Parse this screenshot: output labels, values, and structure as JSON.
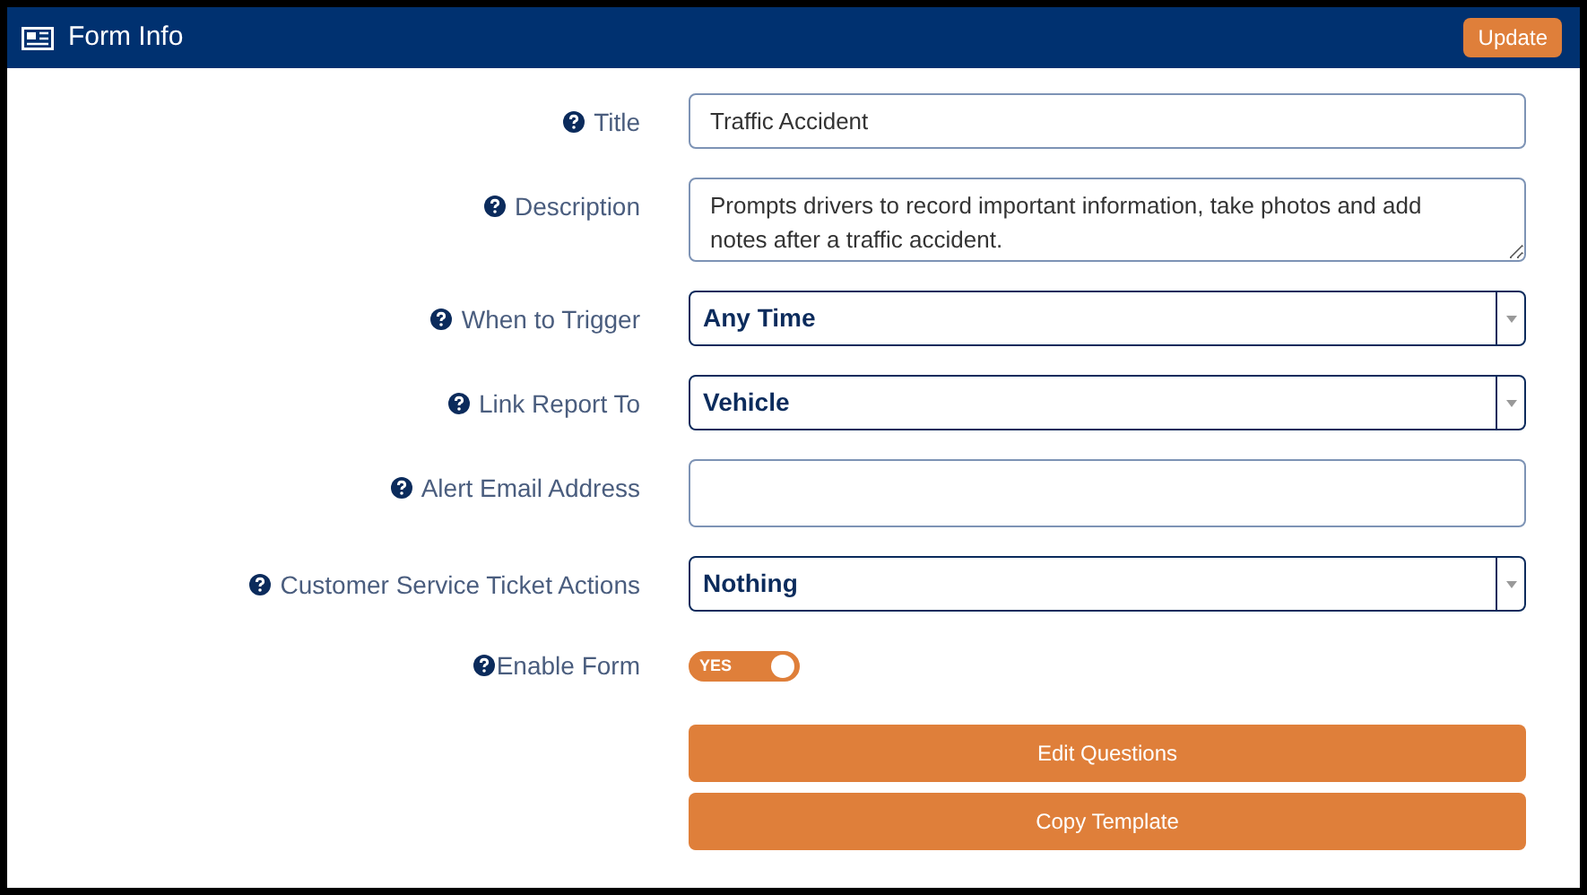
{
  "header": {
    "title": "Form Info",
    "update_button": "Update"
  },
  "fields": [
    {
      "kind": "text",
      "label": "Title",
      "value": "Traffic Accident"
    },
    {
      "kind": "textarea",
      "label": "Description",
      "value": "Prompts drivers to record important information, take photos and add notes after a traffic accident."
    },
    {
      "kind": "select",
      "label": "When to Trigger",
      "value": "Any Time"
    },
    {
      "kind": "select",
      "label": "Link Report To",
      "value": "Vehicle"
    },
    {
      "kind": "text",
      "label": "Alert Email Address"
    },
    {
      "kind": "select",
      "label": "Customer Service Ticket Actions",
      "value": "Nothing"
    },
    {
      "kind": "toggle",
      "label": "Enable Form",
      "on": true,
      "toggle_text": "YES"
    }
  ],
  "buttons": [
    "Edit Questions",
    "Copy Template"
  ]
}
